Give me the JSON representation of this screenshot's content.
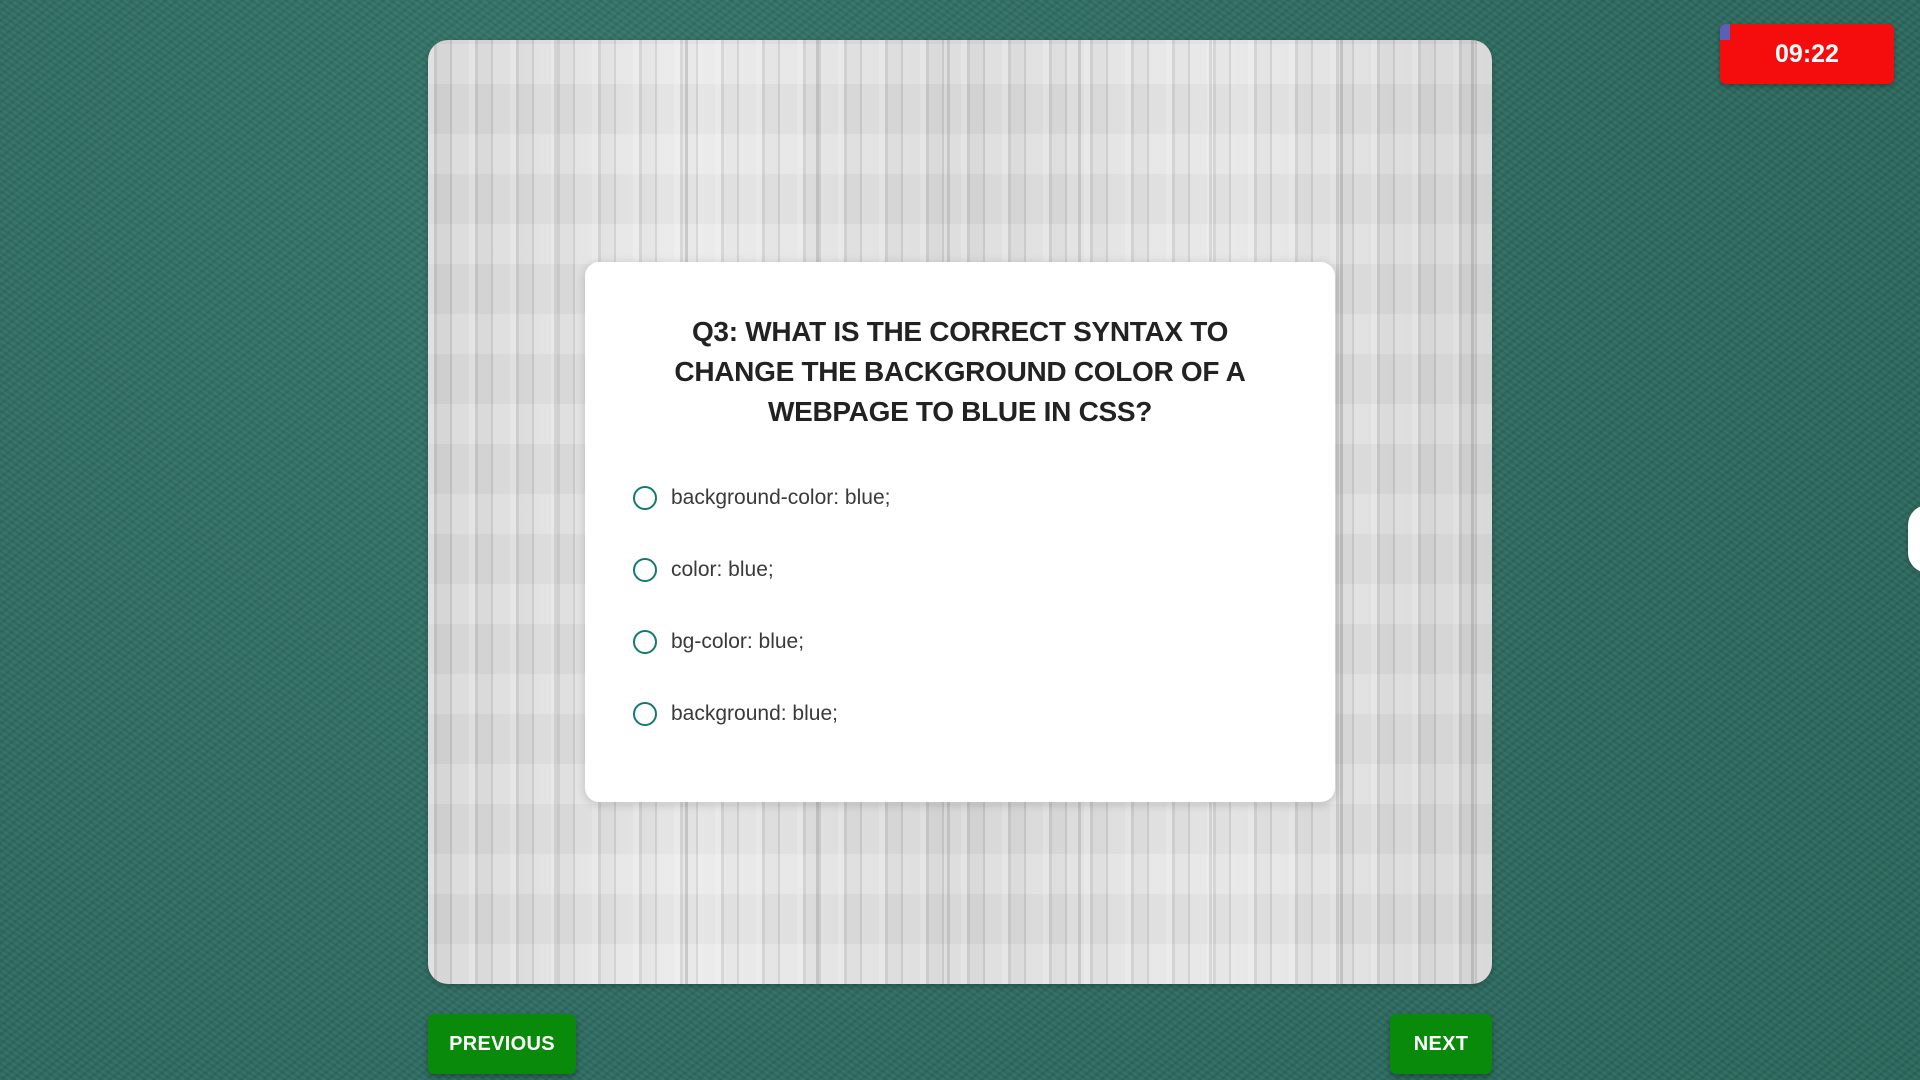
{
  "timer": {
    "value": "09:22",
    "color": "#f50d0d"
  },
  "quiz": {
    "question": "Q3: WHAT IS THE CORRECT SYNTAX TO CHANGE THE BACKGROUND COLOR OF A WEBPAGE TO BLUE IN CSS?",
    "options": [
      {
        "label": "background-color: blue;",
        "selected": false
      },
      {
        "label": "color: blue;",
        "selected": false
      },
      {
        "label": "bg-color: blue;",
        "selected": false
      },
      {
        "label": "background: blue;",
        "selected": false
      }
    ]
  },
  "navigation": {
    "previous_label": "PREVIOUS",
    "next_label": "NEXT",
    "button_color": "#0a8a0a"
  },
  "theme": {
    "background_color": "#2f6e63",
    "radio_color": "#137a6e"
  }
}
